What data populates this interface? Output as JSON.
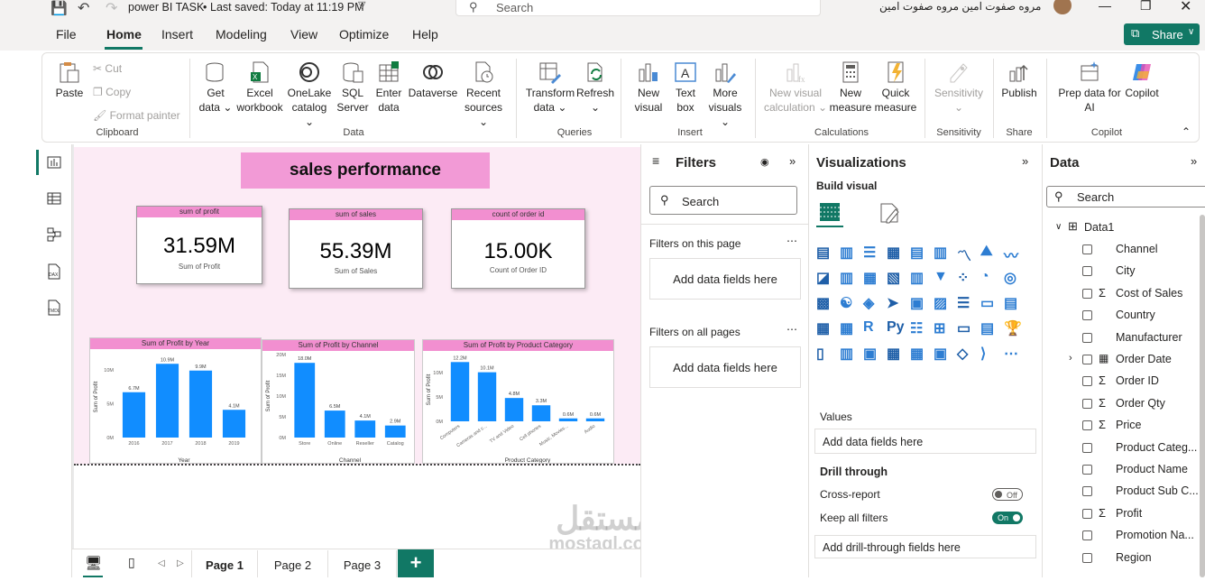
{
  "titlebar": {
    "file_title": "power BI TASK",
    "saved_status": "Last saved: Today at 11:19 PM",
    "search_placeholder": "Search",
    "user_name": "مروه صفوت امين مروه صفوت امين"
  },
  "menu": {
    "tabs": [
      "File",
      "Home",
      "Insert",
      "Modeling",
      "View",
      "Optimize",
      "Help"
    ],
    "active": "Home",
    "share_label": "Share"
  },
  "ribbon": {
    "clipboard": {
      "paste": "Paste",
      "cut": "Cut",
      "copy": "Copy",
      "format_painter": "Format painter",
      "group": "Clipboard"
    },
    "data": {
      "get_data_1": "Get",
      "get_data_2": "data",
      "excel_1": "Excel",
      "excel_2": "workbook",
      "onelake_1": "OneLake",
      "onelake_2": "catalog",
      "sql_1": "SQL",
      "sql_2": "Server",
      "enter_1": "Enter",
      "enter_2": "data",
      "dataverse": "Dataverse",
      "recent_1": "Recent",
      "recent_2": "sources",
      "group": "Data"
    },
    "queries": {
      "transform_1": "Transform",
      "transform_2": "data",
      "refresh": "Refresh",
      "group": "Queries"
    },
    "insert": {
      "new_visual_1": "New",
      "new_visual_2": "visual",
      "text_box_1": "Text",
      "text_box_2": "box",
      "more_1": "More",
      "more_2": "visuals",
      "group": "Insert"
    },
    "calculations": {
      "new_calc_1": "New visual",
      "new_calc_2": "calculation",
      "new_measure_1": "New",
      "new_measure_2": "measure",
      "quick_1": "Quick",
      "quick_2": "measure",
      "group": "Calculations"
    },
    "sensitivity": {
      "label": "Sensitivity",
      "group": "Sensitivity"
    },
    "share": {
      "publish": "Publish",
      "group": "Share"
    },
    "copilot": {
      "prep_1": "Prep data for",
      "prep_2": "AI",
      "copilot": "Copilot",
      "group": "Copilot"
    }
  },
  "report": {
    "title": "sales performance",
    "cards": [
      {
        "header": "sum of profit",
        "value": "31.59M",
        "label": "Sum of Profit"
      },
      {
        "header": "sum of sales",
        "value": "55.39M",
        "label": "Sum of Sales"
      },
      {
        "header": "count of order id",
        "value": "15.00K",
        "label": "Count of Order ID"
      }
    ]
  },
  "chart_data": [
    {
      "type": "bar",
      "title": "Sum of Profit by Year",
      "xlabel": "Year",
      "ylabel": "Sum of Profit",
      "categories": [
        "2016",
        "2017",
        "2018",
        "2019"
      ],
      "values": [
        6.7,
        10.9,
        9.9,
        4.1
      ],
      "data_labels": [
        "6.7M",
        "10.9M",
        "9.9M",
        "4.1M"
      ],
      "ylim": [
        0,
        12
      ],
      "yticks": [
        "0M",
        "5M",
        "10M"
      ],
      "ytick_values": [
        0,
        5,
        10
      ],
      "color": "#118dff"
    },
    {
      "type": "bar",
      "title": "Sum of Profit by Channel",
      "xlabel": "Channel",
      "ylabel": "Sum of Profit",
      "categories": [
        "Store",
        "Online",
        "Reseller",
        "Catalog"
      ],
      "values": [
        18.0,
        6.5,
        4.1,
        2.9
      ],
      "data_labels": [
        "18.0M",
        "6.5M",
        "4.1M",
        "2.9M"
      ],
      "ylim": [
        0,
        20
      ],
      "yticks": [
        "0M",
        "5M",
        "10M",
        "15M",
        "20M"
      ],
      "ytick_values": [
        0,
        5,
        10,
        15,
        20
      ],
      "color": "#118dff"
    },
    {
      "type": "bar",
      "title": "Sum of Profit by Product Category",
      "xlabel": "Product Category",
      "ylabel": "Sum of Profit",
      "categories": [
        "Computers",
        "Cameras and c...",
        "TV and Video",
        "Cell phones",
        "Music, Movies...",
        "Audio"
      ],
      "values": [
        12.2,
        10.1,
        4.8,
        3.3,
        0.6,
        0.6
      ],
      "data_labels": [
        "12.2M",
        "10.1M",
        "4.8M",
        "3.3M",
        "0.6M",
        "0.6M"
      ],
      "ylim": [
        0,
        13
      ],
      "yticks": [
        "0M",
        "5M",
        "10M"
      ],
      "ytick_values": [
        0,
        5,
        10
      ],
      "color": "#118dff"
    }
  ],
  "filters": {
    "title": "Filters",
    "search_placeholder": "Search",
    "this_page": "Filters on this page",
    "all_pages": "Filters on all pages",
    "add_fields": "Add data fields here"
  },
  "visualizations": {
    "title": "Visualizations",
    "build_visual": "Build visual",
    "values": "Values",
    "add_fields": "Add data fields here",
    "drill_through": "Drill through",
    "cross_report": "Cross-report",
    "cross_report_state": "Off",
    "keep_filters": "Keep all filters",
    "keep_filters_state": "On",
    "add_drill": "Add drill-through fields here"
  },
  "data_pane": {
    "title": "Data",
    "search_placeholder": "Search",
    "table": "Data1",
    "fields": [
      {
        "name": "Channel",
        "sigma": false,
        "calendar": false
      },
      {
        "name": "City",
        "sigma": false,
        "calendar": false
      },
      {
        "name": "Cost of Sales",
        "sigma": true,
        "calendar": false
      },
      {
        "name": "Country",
        "sigma": false,
        "calendar": false
      },
      {
        "name": "Manufacturer",
        "sigma": false,
        "calendar": false
      },
      {
        "name": "Order Date",
        "sigma": false,
        "calendar": true
      },
      {
        "name": "Order ID",
        "sigma": true,
        "calendar": false
      },
      {
        "name": "Order Qty",
        "sigma": true,
        "calendar": false
      },
      {
        "name": "Price",
        "sigma": true,
        "calendar": false
      },
      {
        "name": "Product Categ...",
        "sigma": false,
        "calendar": false
      },
      {
        "name": "Product Name",
        "sigma": false,
        "calendar": false
      },
      {
        "name": "Product Sub C...",
        "sigma": false,
        "calendar": false
      },
      {
        "name": "Profit",
        "sigma": true,
        "calendar": false
      },
      {
        "name": "Promotion Na...",
        "sigma": false,
        "calendar": false
      },
      {
        "name": "Region",
        "sigma": false,
        "calendar": false
      }
    ]
  },
  "pages": [
    "Page 1",
    "Page 2",
    "Page 3"
  ],
  "active_page": "Page 1",
  "watermark": {
    "arabic": "مستقل",
    "latin": "mostaql.com"
  }
}
